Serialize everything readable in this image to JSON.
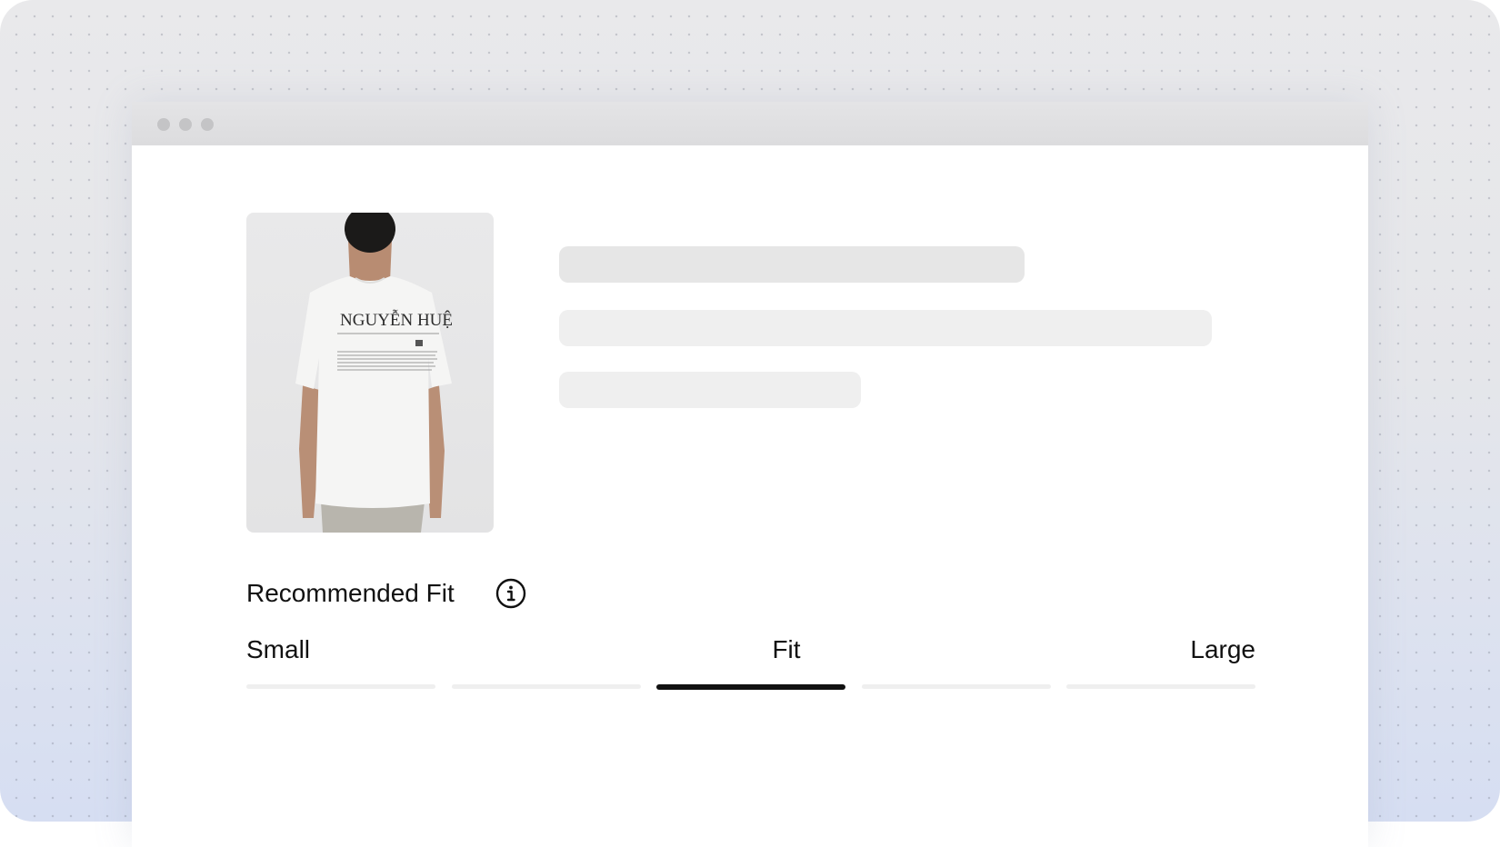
{
  "window": {
    "controls": [
      "dot",
      "dot",
      "dot"
    ]
  },
  "product": {
    "image_alt": "model wearing white t-shirt, back view",
    "shirt_print": "NGUYỄN HUỆ"
  },
  "fit": {
    "title": "Recommended Fit",
    "info_icon": "info-icon",
    "labels": {
      "small": "Small",
      "fit": "Fit",
      "large": "Large"
    },
    "segments_total": 5,
    "selected_segment": 3,
    "colors": {
      "active": "#111111",
      "inactive": "#efefef"
    }
  }
}
